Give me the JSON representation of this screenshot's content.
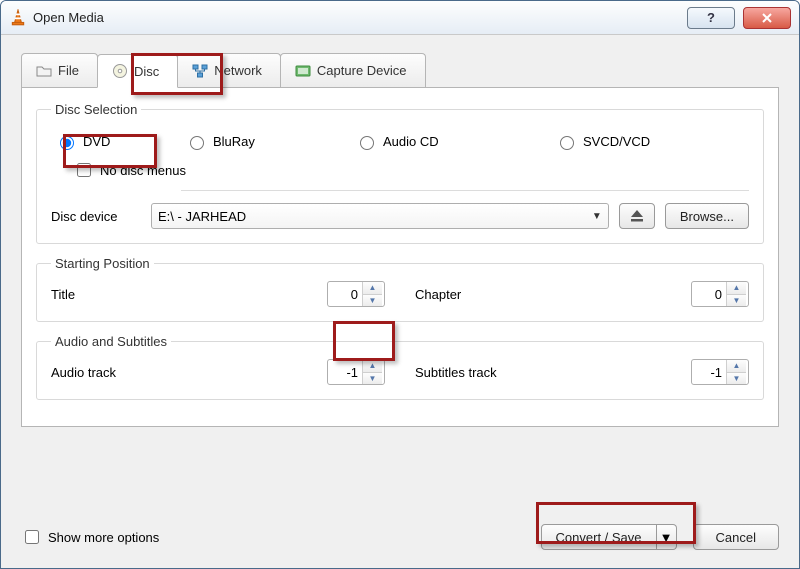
{
  "window": {
    "title": "Open Media"
  },
  "tabs": {
    "file": "File",
    "disc": "Disc",
    "network": "Network",
    "capture": "Capture Device"
  },
  "disc_selection": {
    "legend": "Disc Selection",
    "options": {
      "dvd": "DVD",
      "bluray": "BluRay",
      "audiocd": "Audio CD",
      "svcd": "SVCD/VCD"
    },
    "selected": "dvd",
    "no_menus_label": "No disc menus",
    "no_menus_checked": false,
    "device_label": "Disc device",
    "device_value": "E:\\ - JARHEAD",
    "browse": "Browse..."
  },
  "starting_position": {
    "legend": "Starting Position",
    "title_label": "Title",
    "title_value": "0",
    "chapter_label": "Chapter",
    "chapter_value": "0"
  },
  "audio_subs": {
    "legend": "Audio and Subtitles",
    "audio_label": "Audio track",
    "audio_value": "-1",
    "subs_label": "Subtitles track",
    "subs_value": "-1"
  },
  "footer": {
    "show_more": "Show more options",
    "convert": "Convert / Save",
    "cancel": "Cancel"
  }
}
